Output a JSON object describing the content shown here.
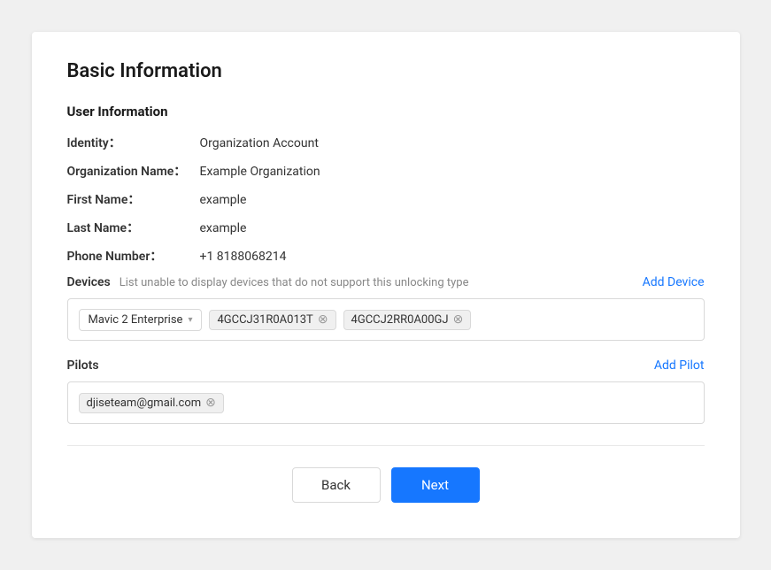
{
  "page": {
    "title": "Basic Information",
    "section_title": "User Information"
  },
  "user_info": {
    "identity_label": "Identity：",
    "identity_value": "Organization Account",
    "org_name_label": "Organization Name：",
    "org_name_value": "Example Organization",
    "first_name_label": "First Name：",
    "first_name_value": "example",
    "last_name_label": "Last Name：",
    "last_name_value": "example",
    "phone_label": "Phone Number：",
    "phone_value": "+1 8188068214"
  },
  "devices": {
    "label": "Devices",
    "hint": "List unable to display devices that do not support this unlocking type",
    "add_label": "Add Device",
    "selected_model": "Mavic 2 Enterprise",
    "tags": [
      {
        "id": "tag-1",
        "value": "4GCCJ31R0A013T"
      },
      {
        "id": "tag-2",
        "value": "4GCCJ2RR0A00GJ"
      }
    ]
  },
  "pilots": {
    "label": "Pilots",
    "add_label": "Add Pilot",
    "tags": [
      {
        "id": "pilot-1",
        "value": "djiseteam@gmail.com"
      }
    ]
  },
  "buttons": {
    "back_label": "Back",
    "next_label": "Next"
  }
}
